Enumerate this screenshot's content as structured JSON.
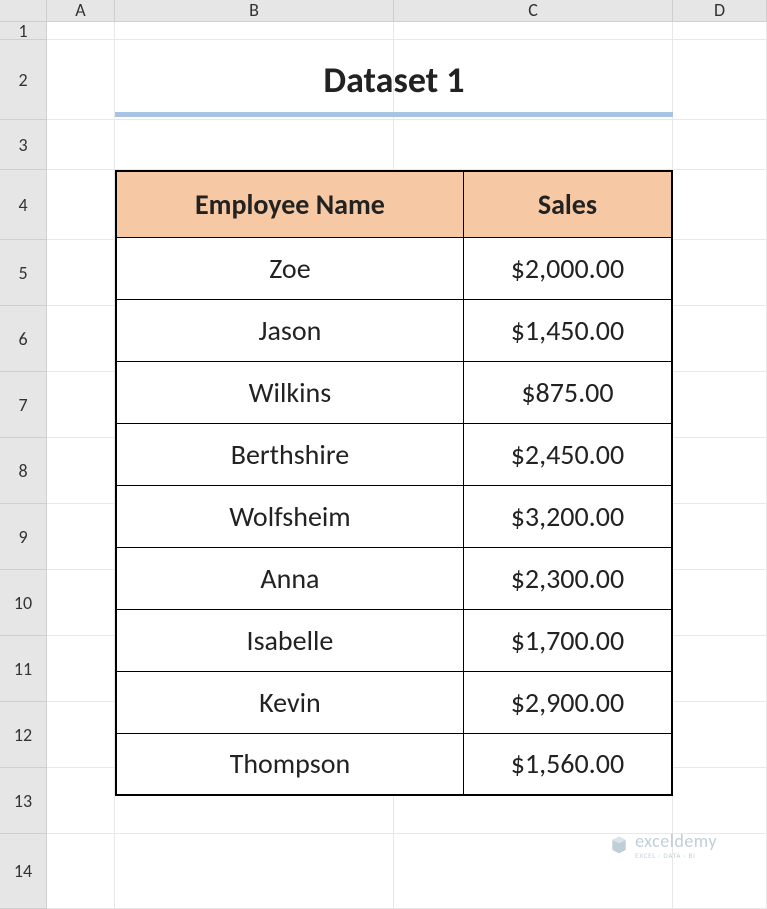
{
  "columns": {
    "A": "A",
    "B": "B",
    "C": "C",
    "D": "D"
  },
  "rows": {
    "r1": "1",
    "r2": "2",
    "r3": "3",
    "r4": "4",
    "r5": "5",
    "r6": "6",
    "r7": "7",
    "r8": "8",
    "r9": "9",
    "r10": "10",
    "r11": "11",
    "r12": "12",
    "r13": "13",
    "r14": "14"
  },
  "title": "Dataset 1",
  "headers": {
    "name": "Employee Name",
    "sales": "Sales"
  },
  "data": [
    {
      "name": "Zoe",
      "sales": "$2,000.00"
    },
    {
      "name": "Jason",
      "sales": "$1,450.00"
    },
    {
      "name": "Wilkins",
      "sales": "$875.00"
    },
    {
      "name": "Berthshire",
      "sales": "$2,450.00"
    },
    {
      "name": "Wolfsheim",
      "sales": "$3,200.00"
    },
    {
      "name": "Anna",
      "sales": "$2,300.00"
    },
    {
      "name": "Isabelle",
      "sales": "$1,700.00"
    },
    {
      "name": "Kevin",
      "sales": "$2,900.00"
    },
    {
      "name": "Thompson",
      "sales": "$1,560.00"
    }
  ],
  "watermark": {
    "text": "exceldemy",
    "sub": "EXCEL · DATA · BI"
  }
}
